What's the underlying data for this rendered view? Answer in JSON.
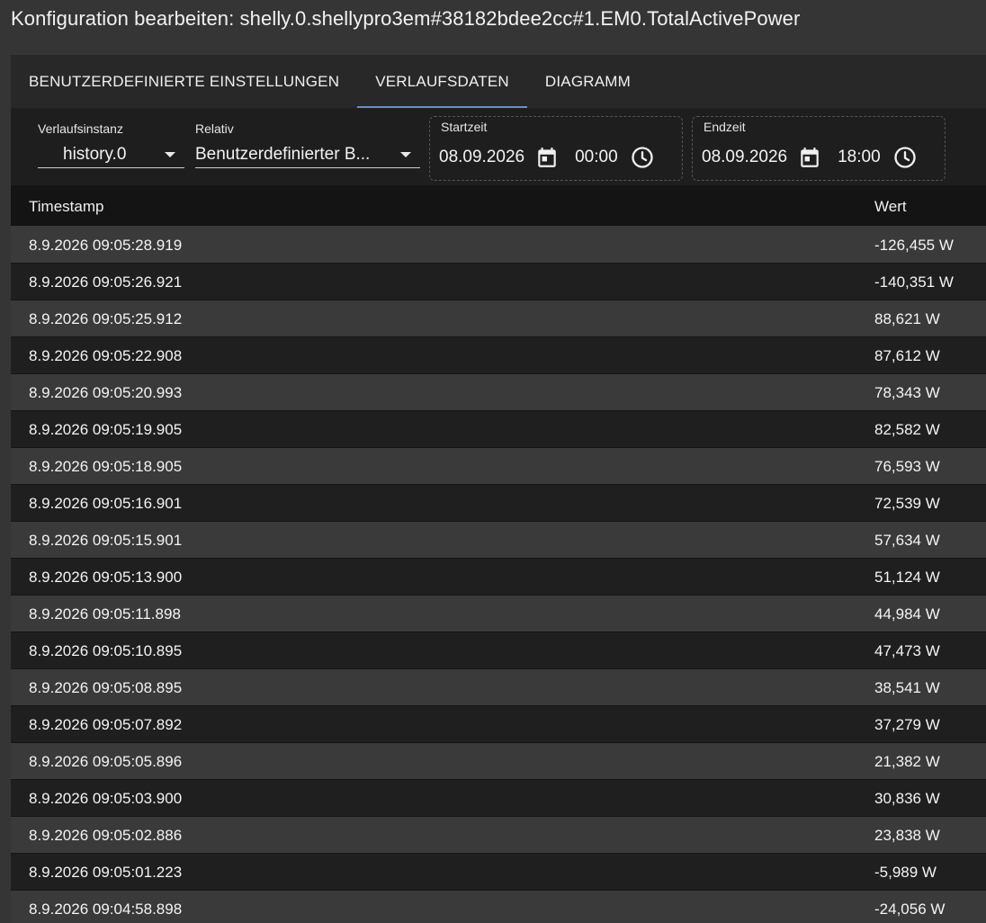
{
  "dialog": {
    "title": "Konfiguration bearbeiten: shelly.0.shellypro3em#38182bdee2cc#1.EM0.TotalActivePower"
  },
  "tabs": [
    {
      "label": "Benutzerdefinierte Einstellungen",
      "active": false
    },
    {
      "label": "Verlaufsdaten",
      "active": true
    },
    {
      "label": "Diagramm",
      "active": false
    }
  ],
  "toolbar": {
    "instance": {
      "label": "Verlaufsinstanz",
      "value": "history.0"
    },
    "relative": {
      "label": "Relativ",
      "value": "Benutzerdefinierter B..."
    },
    "start": {
      "label": "Startzeit",
      "date": "08.09.2026",
      "time": "00:00"
    },
    "end": {
      "label": "Endzeit",
      "date": "08.09.2026",
      "time": "18:00"
    }
  },
  "table": {
    "headers": {
      "timestamp": "Timestamp",
      "value": "Wert"
    },
    "rows": [
      {
        "ts": "8.9.2026 09:05:28.919",
        "val": "-126,455 W"
      },
      {
        "ts": "8.9.2026 09:05:26.921",
        "val": "-140,351 W"
      },
      {
        "ts": "8.9.2026 09:05:25.912",
        "val": "88,621 W"
      },
      {
        "ts": "8.9.2026 09:05:22.908",
        "val": "87,612 W"
      },
      {
        "ts": "8.9.2026 09:05:20.993",
        "val": "78,343 W"
      },
      {
        "ts": "8.9.2026 09:05:19.905",
        "val": "82,582 W"
      },
      {
        "ts": "8.9.2026 09:05:18.905",
        "val": "76,593 W"
      },
      {
        "ts": "8.9.2026 09:05:16.901",
        "val": "72,539 W"
      },
      {
        "ts": "8.9.2026 09:05:15.901",
        "val": "57,634 W"
      },
      {
        "ts": "8.9.2026 09:05:13.900",
        "val": "51,124 W"
      },
      {
        "ts": "8.9.2026 09:05:11.898",
        "val": "44,984 W"
      },
      {
        "ts": "8.9.2026 09:05:10.895",
        "val": "47,473 W"
      },
      {
        "ts": "8.9.2026 09:05:08.895",
        "val": "38,541 W"
      },
      {
        "ts": "8.9.2026 09:05:07.892",
        "val": "37,279 W"
      },
      {
        "ts": "8.9.2026 09:05:05.896",
        "val": "21,382 W"
      },
      {
        "ts": "8.9.2026 09:05:03.900",
        "val": "30,836 W"
      },
      {
        "ts": "8.9.2026 09:05:02.886",
        "val": "23,838 W"
      },
      {
        "ts": "8.9.2026 09:05:01.223",
        "val": "-5,989 W"
      },
      {
        "ts": "8.9.2026 09:04:58.898",
        "val": "-24,056 W"
      }
    ]
  },
  "icons": {
    "calendar": "calendar-icon",
    "clock": "clock-icon",
    "dropdown": "dropdown-caret-icon"
  },
  "colors": {
    "tab_indicator": "#6a8fc2",
    "background": "#353535"
  }
}
